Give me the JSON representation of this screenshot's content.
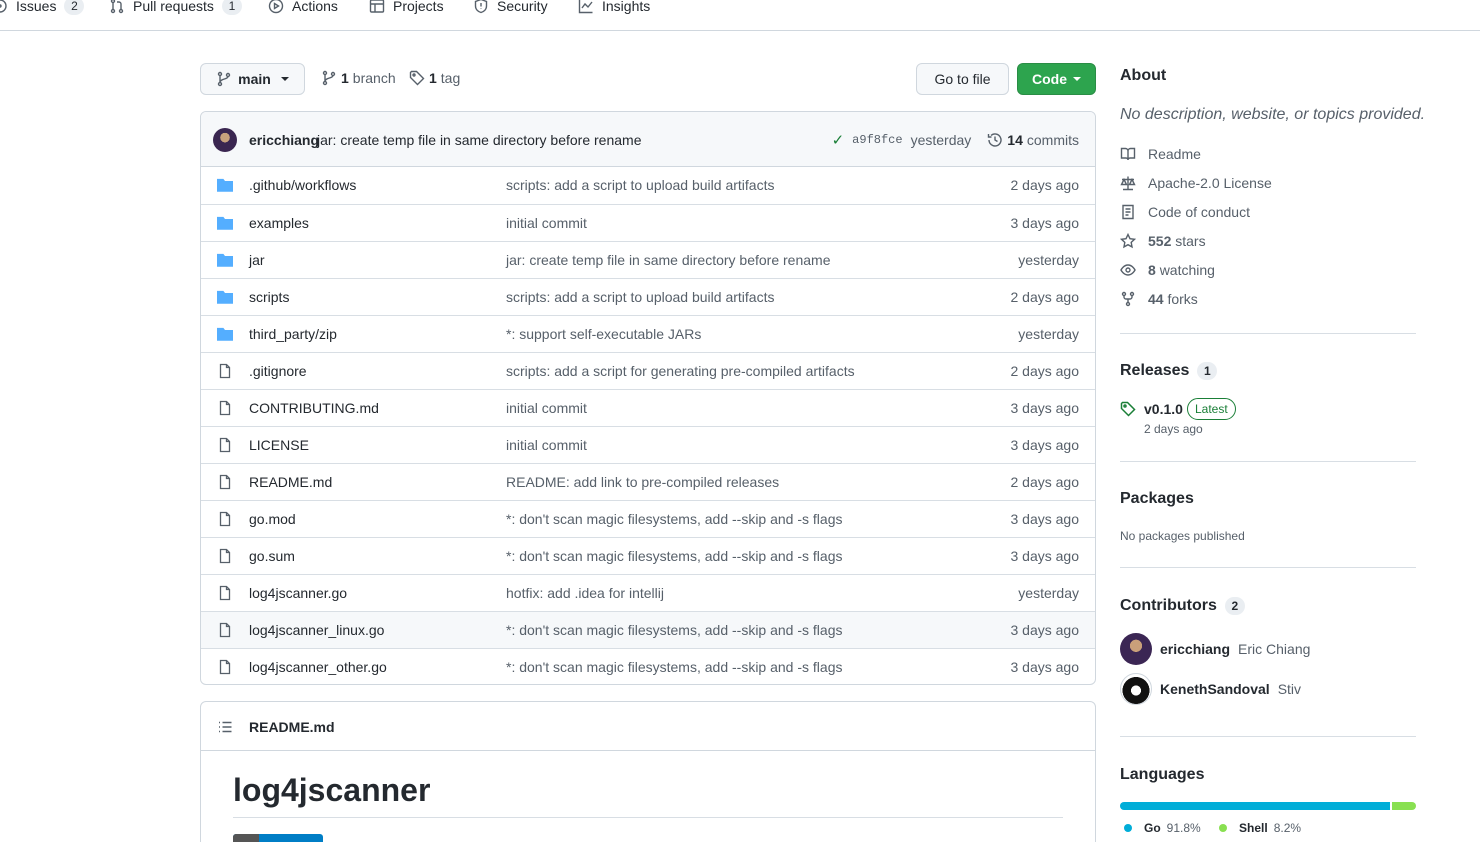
{
  "nav": {
    "tabs": [
      {
        "label": "Issues",
        "count": "2"
      },
      {
        "label": "Pull requests",
        "count": "1"
      },
      {
        "label": "Actions"
      },
      {
        "label": "Projects"
      },
      {
        "label": "Security"
      },
      {
        "label": "Insights"
      }
    ]
  },
  "branch_bar": {
    "branch": "main",
    "branches_count": "1",
    "branches_label": "branch",
    "tags_count": "1",
    "tags_label": "tag",
    "go_to_file": "Go to file",
    "code": "Code"
  },
  "latest_commit": {
    "author": "ericchiang",
    "message": "jar: create temp file in same directory before rename",
    "sha": "a9f8fce",
    "time": "yesterday",
    "commits_count": "14",
    "commits_label": "commits"
  },
  "files": [
    {
      "type": "dir",
      "name": ".github/workflows",
      "message": "scripts: add a script to upload build artifacts",
      "age": "2 days ago"
    },
    {
      "type": "dir",
      "name": "examples",
      "message": "initial commit",
      "age": "3 days ago"
    },
    {
      "type": "dir",
      "name": "jar",
      "message": "jar: create temp file in same directory before rename",
      "age": "yesterday"
    },
    {
      "type": "dir",
      "name": "scripts",
      "message": "scripts: add a script to upload build artifacts",
      "age": "2 days ago"
    },
    {
      "type": "dir",
      "name": "third_party/zip",
      "message": "*: support self-executable JARs",
      "age": "yesterday"
    },
    {
      "type": "file",
      "name": ".gitignore",
      "message": "scripts: add a script for generating pre-compiled artifacts",
      "age": "2 days ago"
    },
    {
      "type": "file",
      "name": "CONTRIBUTING.md",
      "message": "initial commit",
      "age": "3 days ago"
    },
    {
      "type": "file",
      "name": "LICENSE",
      "message": "initial commit",
      "age": "3 days ago"
    },
    {
      "type": "file",
      "name": "README.md",
      "message": "README: add link to pre-compiled releases",
      "age": "2 days ago"
    },
    {
      "type": "file",
      "name": "go.mod",
      "message": "*: don't scan magic filesystems, add --skip and -s flags",
      "age": "3 days ago"
    },
    {
      "type": "file",
      "name": "go.sum",
      "message": "*: don't scan magic filesystems, add --skip and -s flags",
      "age": "3 days ago"
    },
    {
      "type": "file",
      "name": "log4jscanner.go",
      "message": "hotfix: add .idea for intellij",
      "age": "yesterday"
    },
    {
      "type": "file",
      "name": "log4jscanner_linux.go",
      "message": "*: don't scan magic filesystems, add --skip and -s flags",
      "age": "3 days ago"
    },
    {
      "type": "file",
      "name": "log4jscanner_other.go",
      "message": "*: don't scan magic filesystems, add --skip and -s flags",
      "age": "3 days ago"
    }
  ],
  "readme": {
    "file_label": "README.md",
    "heading": "log4jscanner"
  },
  "about": {
    "title": "About",
    "description": "No description, website, or topics provided.",
    "readme": "Readme",
    "license": "Apache-2.0 License",
    "conduct": "Code of conduct",
    "stars_count": "552",
    "stars_label": "stars",
    "watching_count": "8",
    "watching_label": "watching",
    "forks_count": "44",
    "forks_label": "forks"
  },
  "releases": {
    "title": "Releases",
    "count": "1",
    "version": "v0.1.0",
    "badge": "Latest",
    "date": "2 days ago"
  },
  "packages": {
    "title": "Packages",
    "empty": "No packages published"
  },
  "contributors": {
    "title": "Contributors",
    "count": "2",
    "list": [
      {
        "login": "ericchiang",
        "name": "Eric Chiang"
      },
      {
        "login": "KenethSandoval",
        "name": "Stiv"
      }
    ]
  },
  "languages": {
    "title": "Languages",
    "items": [
      {
        "name": "Go",
        "percent": "91.8%",
        "value": 91.8,
        "color": "#00ADD8"
      },
      {
        "name": "Shell",
        "percent": "8.2%",
        "value": 8.2,
        "color": "#89e051"
      }
    ]
  },
  "colors": {
    "primary_button": "#2da44e",
    "folder": "#54aeff",
    "link_green": "#1a7f37"
  }
}
